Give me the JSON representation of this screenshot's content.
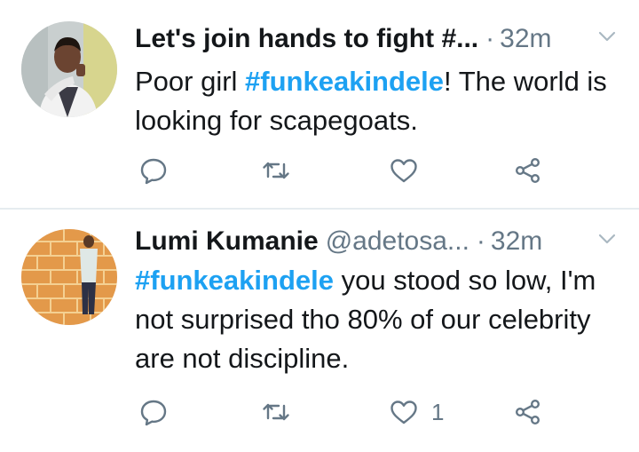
{
  "tweets": [
    {
      "name": "Let's join hands to fight #...",
      "handle": "",
      "time": "32m",
      "text_before": "Poor girl ",
      "hashtag": "#funkeakindele",
      "text_after": "! The world is looking for scapegoats.",
      "like_count": "",
      "avatar_icon": "profile-photo-man-in-vest"
    },
    {
      "name": "Lumi Kumanie",
      "handle": "@adetosa...",
      "time": "32m",
      "text_before": "",
      "hashtag": "#funkeakindele",
      "text_after": " you stood so low, I'm not surprised tho 80% of our celebrity are not discipline.",
      "like_count": "1",
      "avatar_icon": "profile-photo-man-brick-wall"
    }
  ],
  "separator": "·",
  "icons": {
    "reply": "reply-icon",
    "retweet": "retweet-icon",
    "like": "heart-icon",
    "share": "share-icon",
    "menu": "chevron-down-icon"
  },
  "colors": {
    "text": "#14171a",
    "muted": "#657786",
    "hashtag": "#1da1f2",
    "divider": "#e6ecf0"
  }
}
